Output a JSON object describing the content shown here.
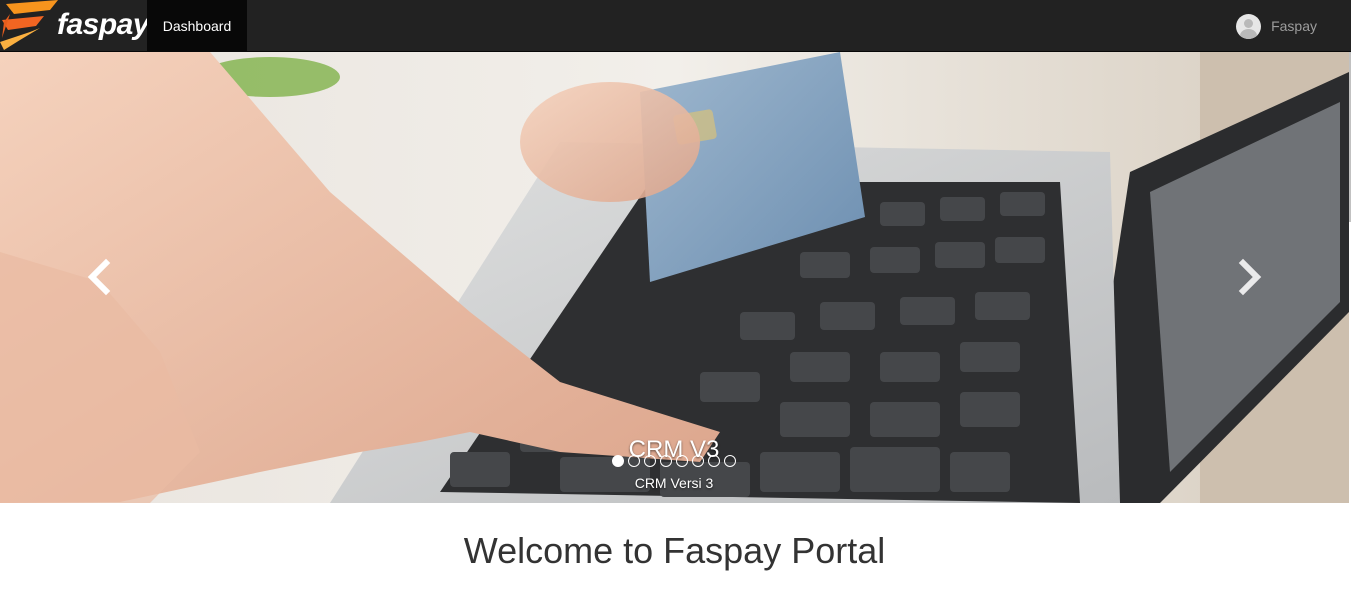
{
  "brand": {
    "name": "faspay",
    "logo_icon": "faspay-logo-icon"
  },
  "nav": {
    "dashboard_label": "Dashboard"
  },
  "user": {
    "name": "Faspay",
    "avatar_icon": "user-avatar-icon"
  },
  "carousel": {
    "image": "hand-typing-laptop-credit-card-photo",
    "caption_title": "CRM V3",
    "caption_subtitle": "CRM Versi 3",
    "indicator_count": 8,
    "active_index": 0,
    "prev_icon": "chevron-left-icon",
    "next_icon": "chevron-right-icon"
  },
  "main": {
    "heading": "Welcome to Faspay Portal"
  },
  "colors": {
    "navbar": "#222222",
    "nav_active": "#080808",
    "accent_orange": "#f7941d"
  }
}
